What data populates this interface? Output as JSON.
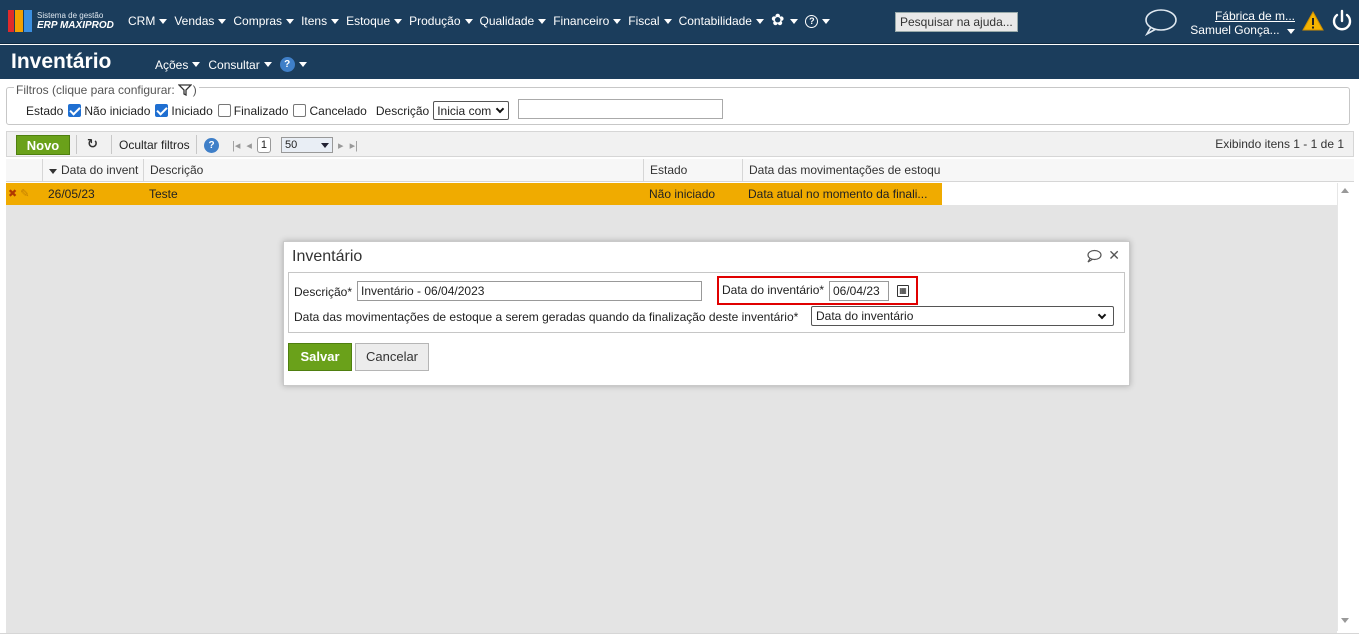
{
  "app": {
    "brand_line1": "Sistema de gestão",
    "brand_line2": "ERP MAXIPROD",
    "menu": [
      "CRM",
      "Vendas",
      "Compras",
      "Itens",
      "Estoque",
      "Produção",
      "Qualidade",
      "Financeiro",
      "Fiscal",
      "Contabilidade"
    ],
    "search_placeholder": "Pesquisar na ajuda...",
    "company": "Fábrica de m...",
    "user": "Samuel Gonça...",
    "colors": {
      "nav": "#1b3d5c",
      "accent_green": "#6aa11a",
      "row_highlight": "#f0ab00",
      "alert_red": "#e00000"
    }
  },
  "page": {
    "title": "Inventário",
    "menu": [
      "Ações",
      "Consultar"
    ]
  },
  "filters": {
    "legend": "Filtros (clique para configurar:",
    "estado_label": "Estado",
    "options": [
      {
        "label": "Não iniciado",
        "checked": true
      },
      {
        "label": "Iniciado",
        "checked": true
      },
      {
        "label": "Finalizado",
        "checked": false
      },
      {
        "label": "Cancelado",
        "checked": false
      }
    ],
    "descricao_label": "Descrição",
    "descricao_mode": "Inicia com",
    "descricao_value": ""
  },
  "toolbar": {
    "novo": "Novo",
    "ocultar": "Ocultar filtros",
    "page": "1",
    "per_page": "50",
    "exibindo": "Exibindo itens 1 - 1 de 1"
  },
  "grid": {
    "columns": [
      "Data do invent",
      "Descrição",
      "Estado",
      "Data das movimentações de estoqu"
    ],
    "rows": [
      {
        "data": "26/05/23",
        "descricao": "Teste",
        "estado": "Não iniciado",
        "movimentacoes": "Data atual no momento da finali..."
      }
    ]
  },
  "modal": {
    "title": "Inventário",
    "descricao_label": "Descrição*",
    "descricao_value": "Inventário - 06/04/2023",
    "data_label": "Data do inventário*",
    "data_value": "06/04/23",
    "mov_label": "Data das movimentações de estoque a serem geradas quando da finalização deste inventário*",
    "mov_value": "Data do inventário",
    "save": "Salvar",
    "cancel": "Cancelar"
  }
}
